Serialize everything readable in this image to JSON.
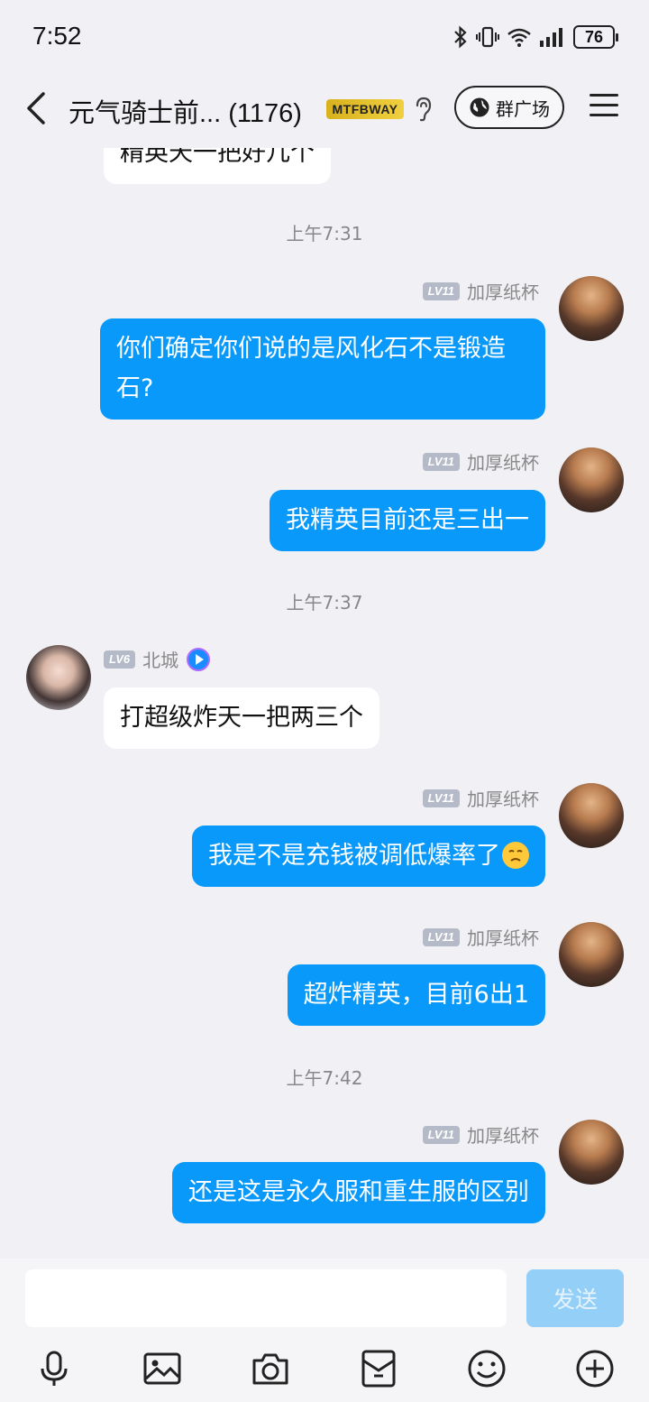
{
  "status_bar": {
    "time": "7:52",
    "battery": "76"
  },
  "header": {
    "title": "元气骑士前... (1176)",
    "badge": "MTFBWAY",
    "plaza_label": "群广场"
  },
  "messages": [
    {
      "kind": "bubble",
      "side": "left",
      "text": "精英天一把好几个"
    },
    {
      "kind": "time",
      "text": "上午7:31"
    },
    {
      "kind": "bubble",
      "side": "right",
      "sender": "加厚纸杯",
      "level": "LV11",
      "text": "你们确定你们说的是风化石不是锻造石?"
    },
    {
      "kind": "bubble",
      "side": "right",
      "sender": "加厚纸杯",
      "level": "LV11",
      "text": "我精英目前还是三出一"
    },
    {
      "kind": "time",
      "text": "上午7:37"
    },
    {
      "kind": "bubble",
      "side": "left",
      "sender": "北城",
      "level": "LV6",
      "text": "打超级炸天一把两三个"
    },
    {
      "kind": "bubble",
      "side": "right",
      "sender": "加厚纸杯",
      "level": "LV11",
      "text": "我是不是充钱被调低爆率了",
      "emoji": "worried-face"
    },
    {
      "kind": "bubble",
      "side": "right",
      "sender": "加厚纸杯",
      "level": "LV11",
      "text": "超炸精英，目前6出1"
    },
    {
      "kind": "time",
      "text": "上午7:42"
    },
    {
      "kind": "bubble",
      "side": "right",
      "sender": "加厚纸杯",
      "level": "LV11",
      "text": "还是这是永久服和重生服的区别"
    }
  ],
  "input": {
    "placeholder": "",
    "send_label": "发送"
  },
  "toolbar": [
    "microphone-icon",
    "image-icon",
    "camera-icon",
    "red-packet-icon",
    "emoji-icon",
    "plus-icon"
  ],
  "colors": {
    "self_bubble": "#0899fa",
    "other_bubble": "#ffffff",
    "background": "#f0f0f5"
  }
}
